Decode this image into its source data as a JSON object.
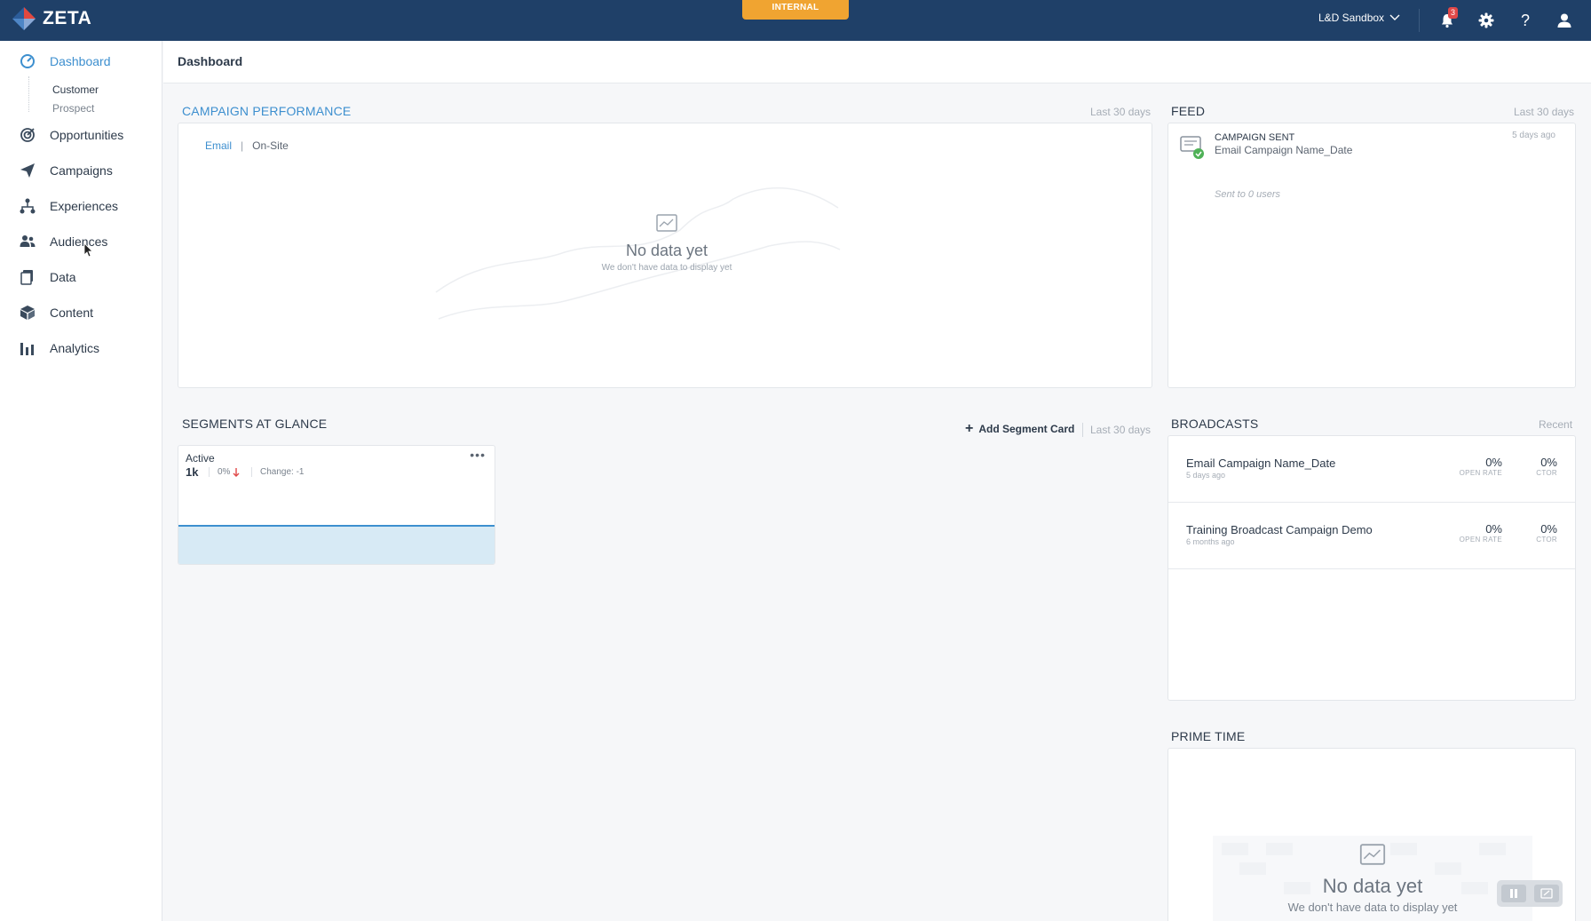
{
  "topbar": {
    "brand": "ZETA",
    "environment_badge": "INTERNAL",
    "tenant": "L&D Sandbox",
    "notification_count": "3"
  },
  "sidebar": {
    "items": [
      {
        "label": "Dashboard",
        "icon": "gauge-icon"
      },
      {
        "label": "Opportunities",
        "icon": "target-icon"
      },
      {
        "label": "Campaigns",
        "icon": "paper-plane-icon"
      },
      {
        "label": "Experiences",
        "icon": "network-icon"
      },
      {
        "label": "Audiences",
        "icon": "users-icon"
      },
      {
        "label": "Data",
        "icon": "database-icon"
      },
      {
        "label": "Content",
        "icon": "box-icon"
      },
      {
        "label": "Analytics",
        "icon": "bar-chart-icon"
      }
    ],
    "dashboard_sub": [
      "Customer",
      "Prospect"
    ]
  },
  "page": {
    "title": "Dashboard"
  },
  "campaign_performance": {
    "title": "CAMPAIGN PERFORMANCE",
    "range": "Last 30 days",
    "tabs": [
      "Email",
      "On-Site"
    ],
    "empty_title": "No data yet",
    "empty_sub": "We don't have data to display yet"
  },
  "feed": {
    "title": "FEED",
    "range": "Last 30 days",
    "item": {
      "type": "CAMPAIGN SENT",
      "name": "Email Campaign Name_Date",
      "time": "5 days ago",
      "detail": "Sent to 0 users"
    }
  },
  "segments": {
    "title": "SEGMENTS AT GLANCE",
    "add_label": "Add Segment Card",
    "range": "Last 30 days",
    "card": {
      "label": "Active",
      "count": "1k",
      "pct": "0%",
      "change": "Change: -1",
      "more": "•••"
    }
  },
  "broadcasts": {
    "title": "BROADCASTS",
    "range": "Recent",
    "rows": [
      {
        "name": "Email Campaign Name_Date",
        "time": "5 days ago",
        "open_rate": "0%",
        "open_label": "OPEN RATE",
        "ctor": "0%",
        "ctor_label": "CTOR"
      },
      {
        "name": "Training Broadcast Campaign Demo",
        "time": "6 months ago",
        "open_rate": "0%",
        "open_label": "OPEN RATE",
        "ctor": "0%",
        "ctor_label": "CTOR"
      }
    ]
  },
  "prime_time": {
    "title": "PRIME TIME",
    "empty_title": "No data yet",
    "empty_sub": "We don't have data to display yet"
  },
  "colors": {
    "topbar": "#1f4068",
    "accent": "#3d8fcf",
    "badge": "#f0a431",
    "alert": "#e04848"
  }
}
